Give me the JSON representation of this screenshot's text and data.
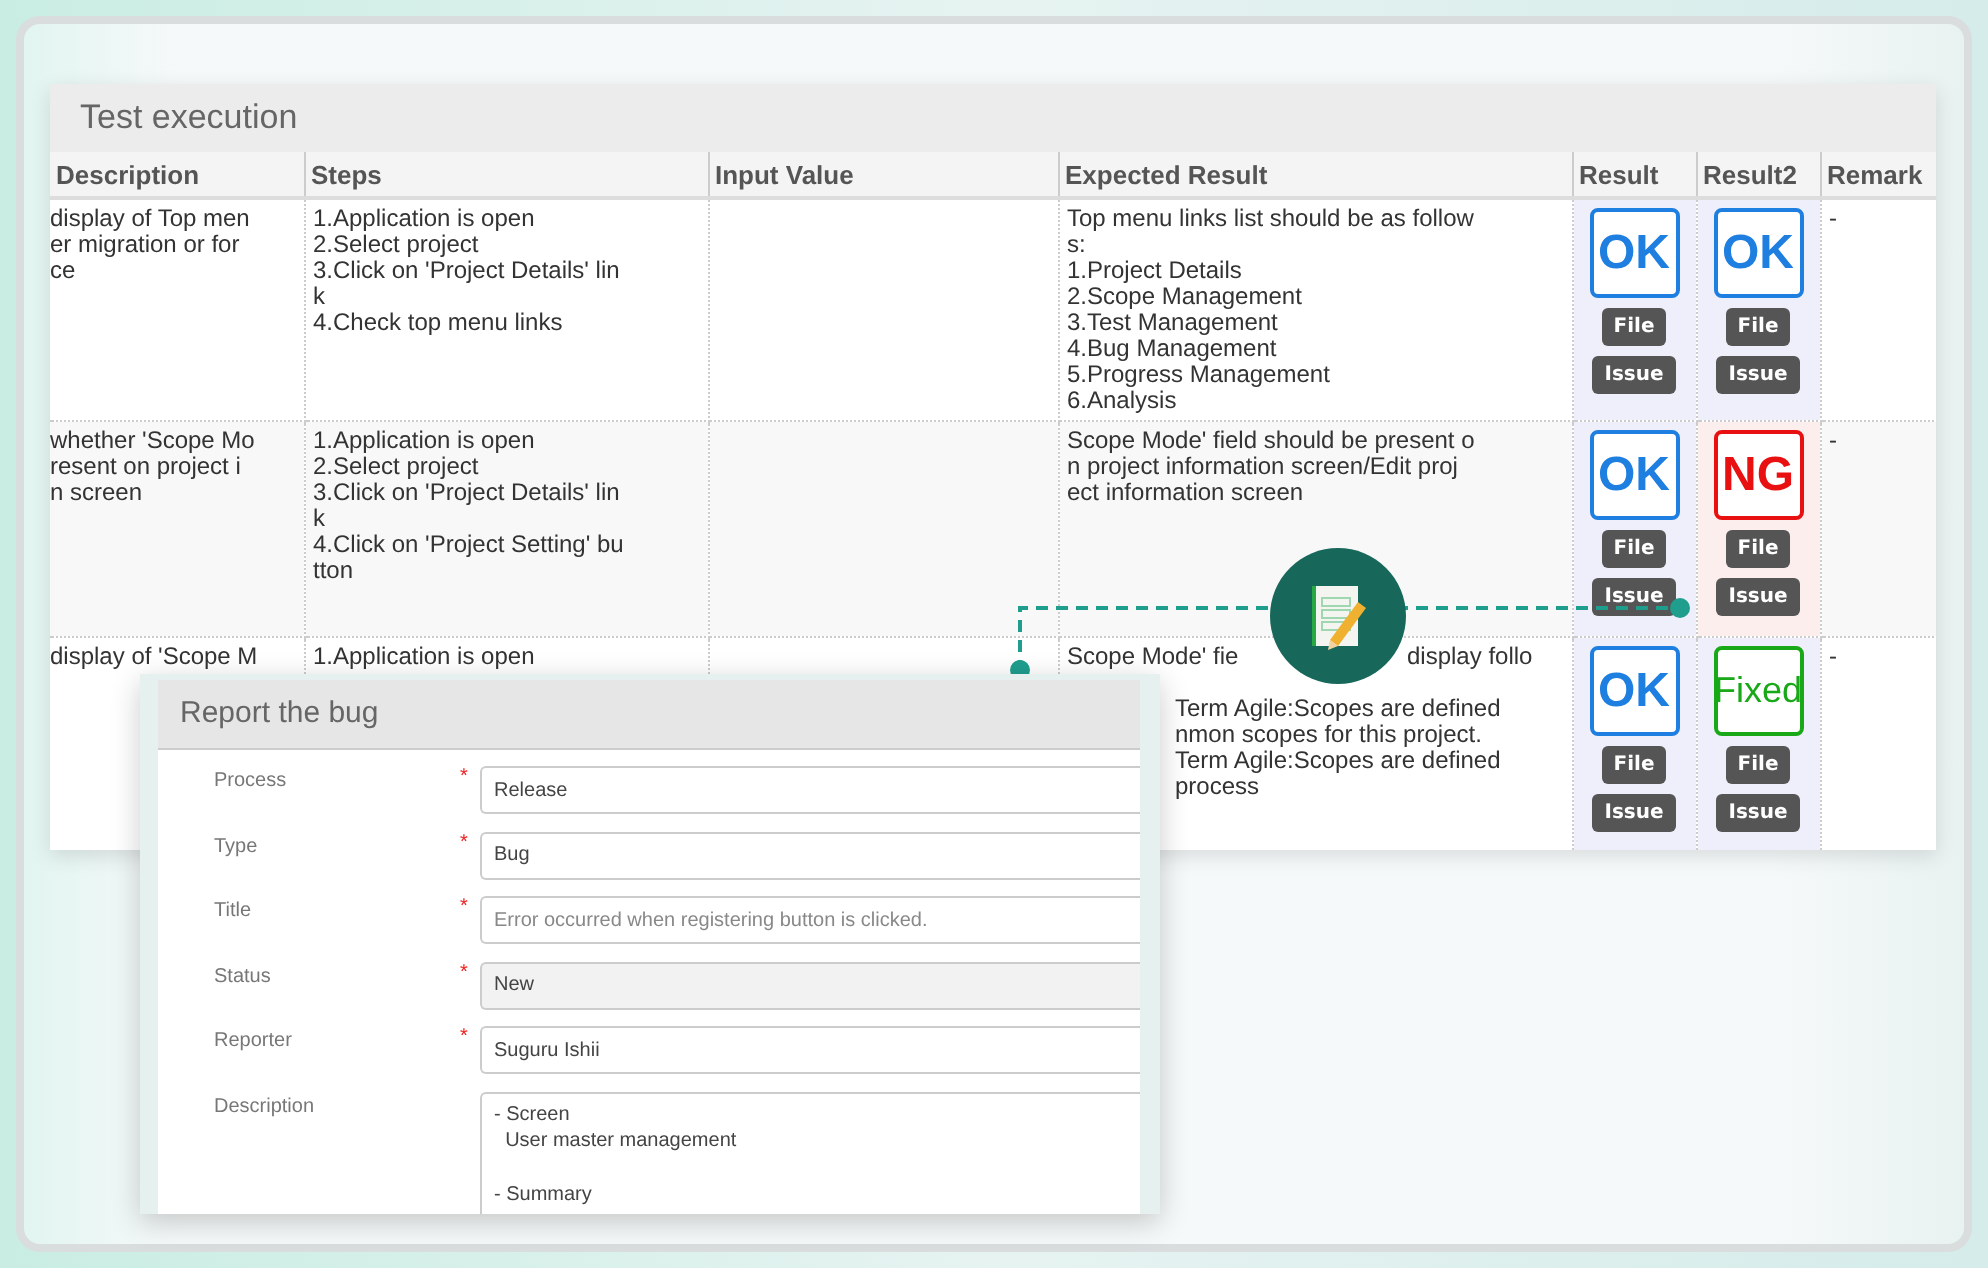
{
  "panel": {
    "title": "Test execution"
  },
  "table": {
    "columns": [
      "Description",
      "Steps",
      "Input Value",
      "Expected Result",
      "Result",
      "Result2",
      "Remark"
    ],
    "rows": [
      {
        "description": [
          "display of Top men",
          "er migration or for",
          "ce"
        ],
        "steps": [
          "1.Application is open",
          "2.Select project",
          "3.Click on 'Project Details' lin",
          "k",
          "4.Check top menu links"
        ],
        "expected_result": [
          "Top menu links list should be as follow",
          "s:",
          "1.Project Details",
          "2.Scope Management",
          "3.Test Management",
          "4.Bug Management",
          "5.Progress Management",
          "6.Analysis"
        ],
        "results": [
          {
            "label": "OK",
            "kind": "ok",
            "buttons": [
              "File",
              "Issue"
            ]
          },
          {
            "label": "OK",
            "kind": "ok",
            "buttons": [
              "File",
              "Issue"
            ]
          }
        ],
        "remark": "-"
      },
      {
        "description": [
          "whether 'Scope Mo",
          "resent on project i",
          "n screen"
        ],
        "steps": [
          "1.Application is open",
          "2.Select project",
          "3.Click on 'Project Details' lin",
          "k",
          "4.Click on 'Project Setting' bu",
          "tton"
        ],
        "expected_result": [
          "Scope Mode' field should be present o",
          "n project information screen/Edit proj",
          "ect information screen"
        ],
        "results": [
          {
            "label": "OK",
            "kind": "ok",
            "buttons": [
              "File",
              "Issue"
            ]
          },
          {
            "label": "NG",
            "kind": "ng",
            "buttons": [
              "File",
              "Issue"
            ]
          }
        ],
        "remark": "-"
      },
      {
        "description": [
          "display of 'Scope M"
        ],
        "steps": [
          "1.Application is open"
        ],
        "expected_result": [
          "Scope Mode' fie"
        ],
        "expected_result_after_icon": "display follo",
        "expected_result_beside_dialog": [
          "Term Agile:Scopes are defined",
          "nmon scopes for this project.",
          "Term Agile:Scopes are defined",
          "process"
        ],
        "results": [
          {
            "label": "OK",
            "kind": "ok",
            "buttons": [
              "File",
              "Issue"
            ]
          },
          {
            "label": "Fixed",
            "kind": "fixed",
            "buttons": [
              "File",
              "Issue"
            ]
          }
        ],
        "remark": "-"
      }
    ]
  },
  "dialog": {
    "title": "Report the bug",
    "required_mark": "*",
    "fields": [
      {
        "label": "Process",
        "required": true,
        "kind": "input",
        "value": "Release",
        "disabled": false
      },
      {
        "label": "Type",
        "required": true,
        "kind": "input",
        "value": "Bug",
        "disabled": false
      },
      {
        "label": "Title",
        "required": true,
        "kind": "input",
        "placeholder": "Error occurred when registering button is clicked.",
        "disabled": false
      },
      {
        "label": "Status",
        "required": true,
        "kind": "input",
        "value": "New",
        "disabled": true
      },
      {
        "label": "Reporter",
        "required": true,
        "kind": "input",
        "value": "Suguru Ishii",
        "disabled": false
      },
      {
        "label": "Description",
        "required": false,
        "kind": "textarea",
        "value": "- Screen\n  User master management\n\n- Summary",
        "disabled": false
      }
    ]
  }
}
